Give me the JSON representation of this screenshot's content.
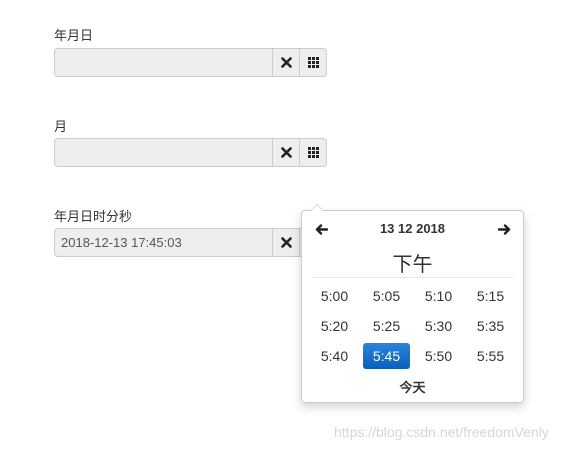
{
  "fields": [
    {
      "label": "年月日",
      "value": ""
    },
    {
      "label": "月",
      "value": ""
    },
    {
      "label": "年月日时分秒",
      "value": "2018-12-13 17:45:03"
    }
  ],
  "icons": {
    "clear": "close-icon",
    "calendar": "grid-icon"
  },
  "picker": {
    "prev_arrow": "🡐",
    "next_arrow": "🡒",
    "title": "13 12 2018",
    "meridiem": "下午",
    "times": [
      "5:00",
      "5:05",
      "5:10",
      "5:15",
      "5:20",
      "5:25",
      "5:30",
      "5:35",
      "5:40",
      "5:45",
      "5:50",
      "5:55"
    ],
    "selected": "5:45",
    "today_label": "今天",
    "accent_color": "#1f73cc"
  },
  "watermark": "https://blog.csdn.net/freedomVenly"
}
